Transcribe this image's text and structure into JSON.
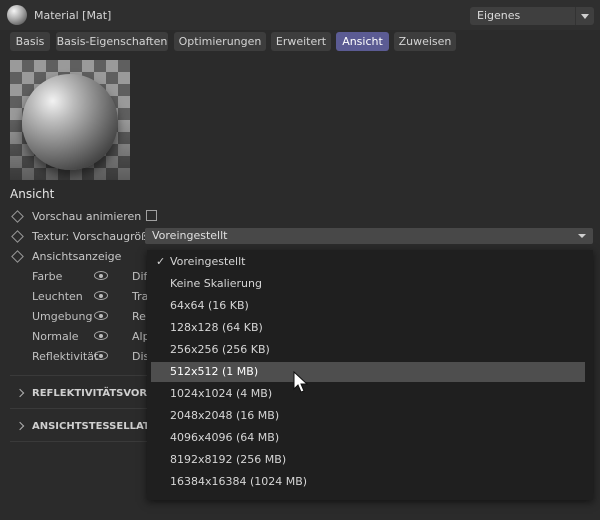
{
  "header": {
    "title": "Material [Mat]",
    "mode_dropdown": {
      "value": "Eigenes"
    }
  },
  "tabs": [
    "Basis",
    "Basis-Eigenschaften",
    "Optimierungen",
    "Erweitert",
    "Ansicht",
    "Zuweisen"
  ],
  "active_tab": "Ansicht",
  "section": {
    "title": "Ansicht",
    "preview_animate_label": "Vorschau animieren",
    "texture_size_label": "Textur: Vorschaugröße",
    "texture_size_value": "Voreingestellt",
    "view_display_label": "Ansichtsanzeige",
    "channels": [
      {
        "label": "Farbe",
        "trail": "Dif"
      },
      {
        "label": "Leuchten",
        "trail": "Tra"
      },
      {
        "label": "Umgebung",
        "trail": "Re"
      },
      {
        "label": "Normale",
        "trail": "Alp"
      },
      {
        "label": "Reflektivität",
        "trail": "Dis"
      }
    ]
  },
  "collapsed_groups": [
    {
      "label": "REFLEKTIVITÄTSVORSCH"
    },
    {
      "label": "ANSICHTSTESSELLATION"
    }
  ],
  "dropdown_menu": {
    "items": [
      {
        "label": "Voreingestellt",
        "checked": true,
        "highlighted": false
      },
      {
        "label": "Keine Skalierung",
        "checked": false,
        "highlighted": false
      },
      {
        "label": "64x64 (16 KB)",
        "checked": false,
        "highlighted": false
      },
      {
        "label": "128x128 (64 KB)",
        "checked": false,
        "highlighted": false
      },
      {
        "label": "256x256 (256 KB)",
        "checked": false,
        "highlighted": false
      },
      {
        "label": "512x512 (1 MB)",
        "checked": false,
        "highlighted": true
      },
      {
        "label": "1024x1024 (4 MB)",
        "checked": false,
        "highlighted": false
      },
      {
        "label": "2048x2048 (16 MB)",
        "checked": false,
        "highlighted": false
      },
      {
        "label": "4096x4096 (64 MB)",
        "checked": false,
        "highlighted": false
      },
      {
        "label": "8192x8192 (256 MB)",
        "checked": false,
        "highlighted": false
      },
      {
        "label": "16384x16384 (1024 MB)",
        "checked": false,
        "highlighted": false
      }
    ]
  },
  "colors": {
    "background": "#2b2b2b",
    "active_tab": "#5b5b93",
    "menu_background": "#1f1f1f",
    "menu_highlight": "#4e4e4e"
  },
  "icons": {
    "material": "material-sphere-icon",
    "check": "checkmark-icon",
    "eye": "eye-icon",
    "cursor": "mouse-pointer-icon"
  }
}
